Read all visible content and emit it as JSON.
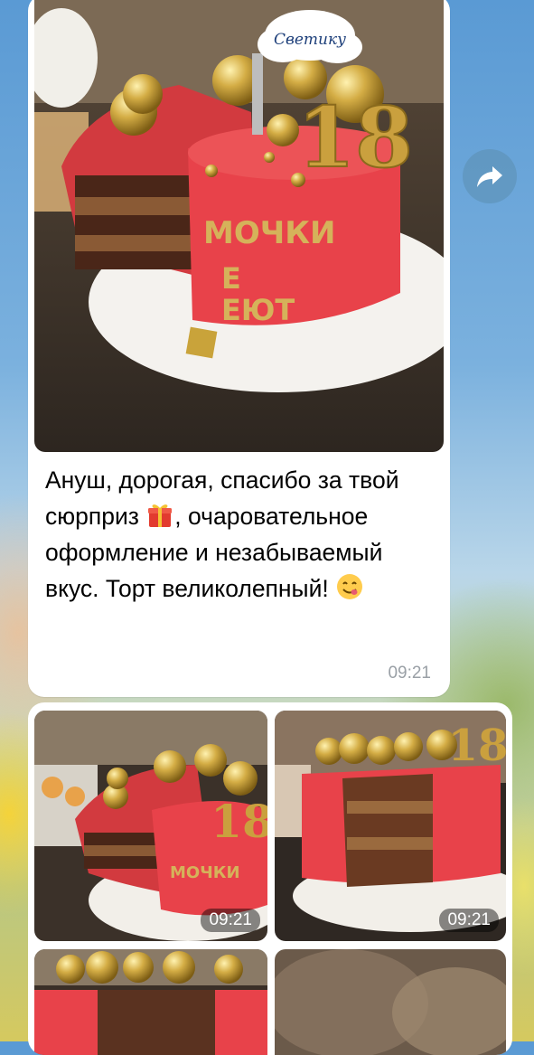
{
  "message": {
    "caption": "Ануш, дорогая, спасибо за твой сюрприз",
    "caption_rest": ", очаровательное оформление и незабываемый вкус. Торт великолепный!",
    "time": "09:21",
    "topper_text": "Светику",
    "cake_text": [
      "МОЧКИ",
      "Е",
      "ЕЮТ"
    ],
    "number_topper": "18"
  },
  "album": {
    "thumbs": [
      {
        "time": "09:21"
      },
      {
        "time": "09:21"
      }
    ]
  },
  "colors": {
    "cake_red": "#e8424a",
    "gold": "#c9a33a",
    "bubble": "#ffffff",
    "timestamp": "#9aa0a6"
  },
  "icons": {
    "share": "share-arrow-icon",
    "gift": "gift-emoji",
    "yum": "yum-face-emoji"
  }
}
